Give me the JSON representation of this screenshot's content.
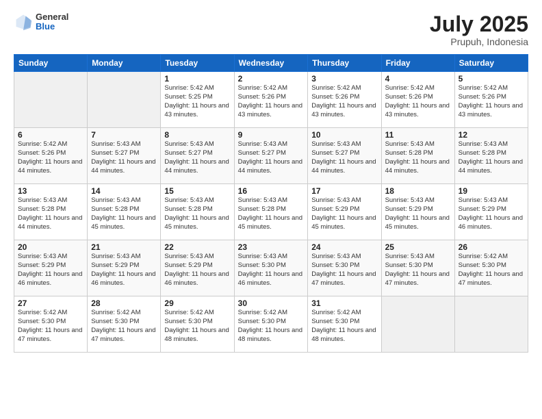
{
  "header": {
    "logo_general": "General",
    "logo_blue": "Blue",
    "title": "July 2025",
    "location": "Prupuh, Indonesia"
  },
  "weekdays": [
    "Sunday",
    "Monday",
    "Tuesday",
    "Wednesday",
    "Thursday",
    "Friday",
    "Saturday"
  ],
  "weeks": [
    [
      {
        "day": "",
        "info": ""
      },
      {
        "day": "",
        "info": ""
      },
      {
        "day": "1",
        "info": "Sunrise: 5:42 AM\nSunset: 5:25 PM\nDaylight: 11 hours and 43 minutes."
      },
      {
        "day": "2",
        "info": "Sunrise: 5:42 AM\nSunset: 5:26 PM\nDaylight: 11 hours and 43 minutes."
      },
      {
        "day": "3",
        "info": "Sunrise: 5:42 AM\nSunset: 5:26 PM\nDaylight: 11 hours and 43 minutes."
      },
      {
        "day": "4",
        "info": "Sunrise: 5:42 AM\nSunset: 5:26 PM\nDaylight: 11 hours and 43 minutes."
      },
      {
        "day": "5",
        "info": "Sunrise: 5:42 AM\nSunset: 5:26 PM\nDaylight: 11 hours and 43 minutes."
      }
    ],
    [
      {
        "day": "6",
        "info": "Sunrise: 5:42 AM\nSunset: 5:26 PM\nDaylight: 11 hours and 44 minutes."
      },
      {
        "day": "7",
        "info": "Sunrise: 5:43 AM\nSunset: 5:27 PM\nDaylight: 11 hours and 44 minutes."
      },
      {
        "day": "8",
        "info": "Sunrise: 5:43 AM\nSunset: 5:27 PM\nDaylight: 11 hours and 44 minutes."
      },
      {
        "day": "9",
        "info": "Sunrise: 5:43 AM\nSunset: 5:27 PM\nDaylight: 11 hours and 44 minutes."
      },
      {
        "day": "10",
        "info": "Sunrise: 5:43 AM\nSunset: 5:27 PM\nDaylight: 11 hours and 44 minutes."
      },
      {
        "day": "11",
        "info": "Sunrise: 5:43 AM\nSunset: 5:28 PM\nDaylight: 11 hours and 44 minutes."
      },
      {
        "day": "12",
        "info": "Sunrise: 5:43 AM\nSunset: 5:28 PM\nDaylight: 11 hours and 44 minutes."
      }
    ],
    [
      {
        "day": "13",
        "info": "Sunrise: 5:43 AM\nSunset: 5:28 PM\nDaylight: 11 hours and 44 minutes."
      },
      {
        "day": "14",
        "info": "Sunrise: 5:43 AM\nSunset: 5:28 PM\nDaylight: 11 hours and 45 minutes."
      },
      {
        "day": "15",
        "info": "Sunrise: 5:43 AM\nSunset: 5:28 PM\nDaylight: 11 hours and 45 minutes."
      },
      {
        "day": "16",
        "info": "Sunrise: 5:43 AM\nSunset: 5:28 PM\nDaylight: 11 hours and 45 minutes."
      },
      {
        "day": "17",
        "info": "Sunrise: 5:43 AM\nSunset: 5:29 PM\nDaylight: 11 hours and 45 minutes."
      },
      {
        "day": "18",
        "info": "Sunrise: 5:43 AM\nSunset: 5:29 PM\nDaylight: 11 hours and 45 minutes."
      },
      {
        "day": "19",
        "info": "Sunrise: 5:43 AM\nSunset: 5:29 PM\nDaylight: 11 hours and 46 minutes."
      }
    ],
    [
      {
        "day": "20",
        "info": "Sunrise: 5:43 AM\nSunset: 5:29 PM\nDaylight: 11 hours and 46 minutes."
      },
      {
        "day": "21",
        "info": "Sunrise: 5:43 AM\nSunset: 5:29 PM\nDaylight: 11 hours and 46 minutes."
      },
      {
        "day": "22",
        "info": "Sunrise: 5:43 AM\nSunset: 5:29 PM\nDaylight: 11 hours and 46 minutes."
      },
      {
        "day": "23",
        "info": "Sunrise: 5:43 AM\nSunset: 5:30 PM\nDaylight: 11 hours and 46 minutes."
      },
      {
        "day": "24",
        "info": "Sunrise: 5:43 AM\nSunset: 5:30 PM\nDaylight: 11 hours and 47 minutes."
      },
      {
        "day": "25",
        "info": "Sunrise: 5:43 AM\nSunset: 5:30 PM\nDaylight: 11 hours and 47 minutes."
      },
      {
        "day": "26",
        "info": "Sunrise: 5:42 AM\nSunset: 5:30 PM\nDaylight: 11 hours and 47 minutes."
      }
    ],
    [
      {
        "day": "27",
        "info": "Sunrise: 5:42 AM\nSunset: 5:30 PM\nDaylight: 11 hours and 47 minutes."
      },
      {
        "day": "28",
        "info": "Sunrise: 5:42 AM\nSunset: 5:30 PM\nDaylight: 11 hours and 47 minutes."
      },
      {
        "day": "29",
        "info": "Sunrise: 5:42 AM\nSunset: 5:30 PM\nDaylight: 11 hours and 48 minutes."
      },
      {
        "day": "30",
        "info": "Sunrise: 5:42 AM\nSunset: 5:30 PM\nDaylight: 11 hours and 48 minutes."
      },
      {
        "day": "31",
        "info": "Sunrise: 5:42 AM\nSunset: 5:30 PM\nDaylight: 11 hours and 48 minutes."
      },
      {
        "day": "",
        "info": ""
      },
      {
        "day": "",
        "info": ""
      }
    ]
  ]
}
